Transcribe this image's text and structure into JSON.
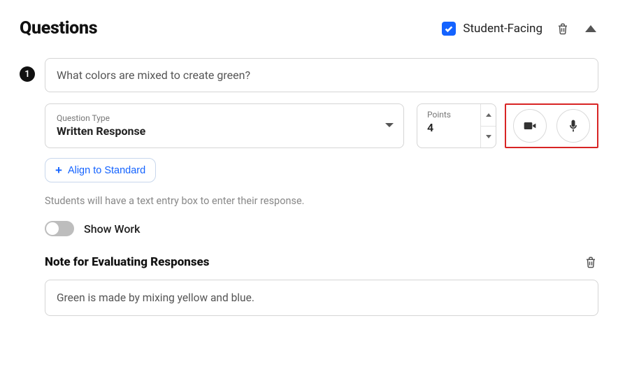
{
  "header": {
    "title": "Questions",
    "student_facing_label": "Student-Facing",
    "student_facing_checked": true
  },
  "question": {
    "number": "1",
    "prompt": "What colors are mixed to create green?",
    "type_label": "Question Type",
    "type_value": "Written Response",
    "points_label": "Points",
    "points_value": "4",
    "align_label": "Align to Standard",
    "helper_text": "Students will have a text entry box to enter their response.",
    "show_work_label": "Show Work",
    "show_work_on": false,
    "note_title": "Note for Evaluating Responses",
    "note_value": "Green is made by mixing yellow and blue."
  }
}
